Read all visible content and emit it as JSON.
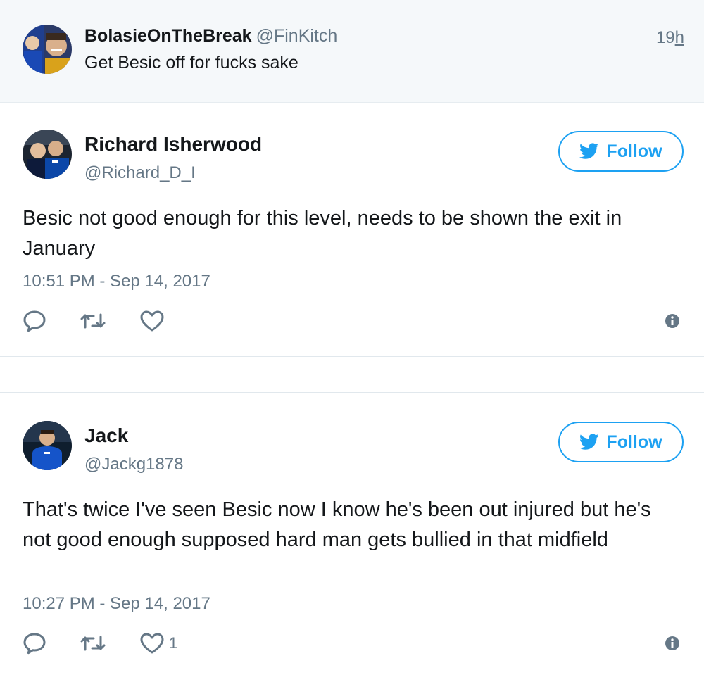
{
  "parent_tweet": {
    "name": "BolasieOnTheBreak",
    "handle": "@FinKitch",
    "time_num": "19",
    "time_unit": "h",
    "text": "Get Besic off for fucks sake"
  },
  "tweets": [
    {
      "name": "Richard Isherwood",
      "handle": "@Richard_D_I",
      "follow_label": "Follow",
      "text": "Besic not good enough for this level, needs to be shown the exit in January",
      "timestamp": "10:51 PM - Sep 14, 2017",
      "like_count": ""
    },
    {
      "name": "Jack",
      "handle": "@Jackg1878",
      "follow_label": "Follow",
      "text": "That's twice I've seen Besic now I know he's been out injured but he's not good enough supposed hard man gets bullied in that midfield",
      "timestamp": "10:27 PM - Sep 14, 2017",
      "like_count": "1"
    }
  ],
  "icons": {
    "reply": "reply-icon",
    "retweet": "retweet-icon",
    "like": "heart-icon",
    "info": "info-icon",
    "bird": "twitter-bird-icon"
  },
  "colors": {
    "accent": "#1da1f2",
    "text": "#14171a",
    "secondary": "#657786",
    "parent_bg": "#f5f8fa"
  }
}
